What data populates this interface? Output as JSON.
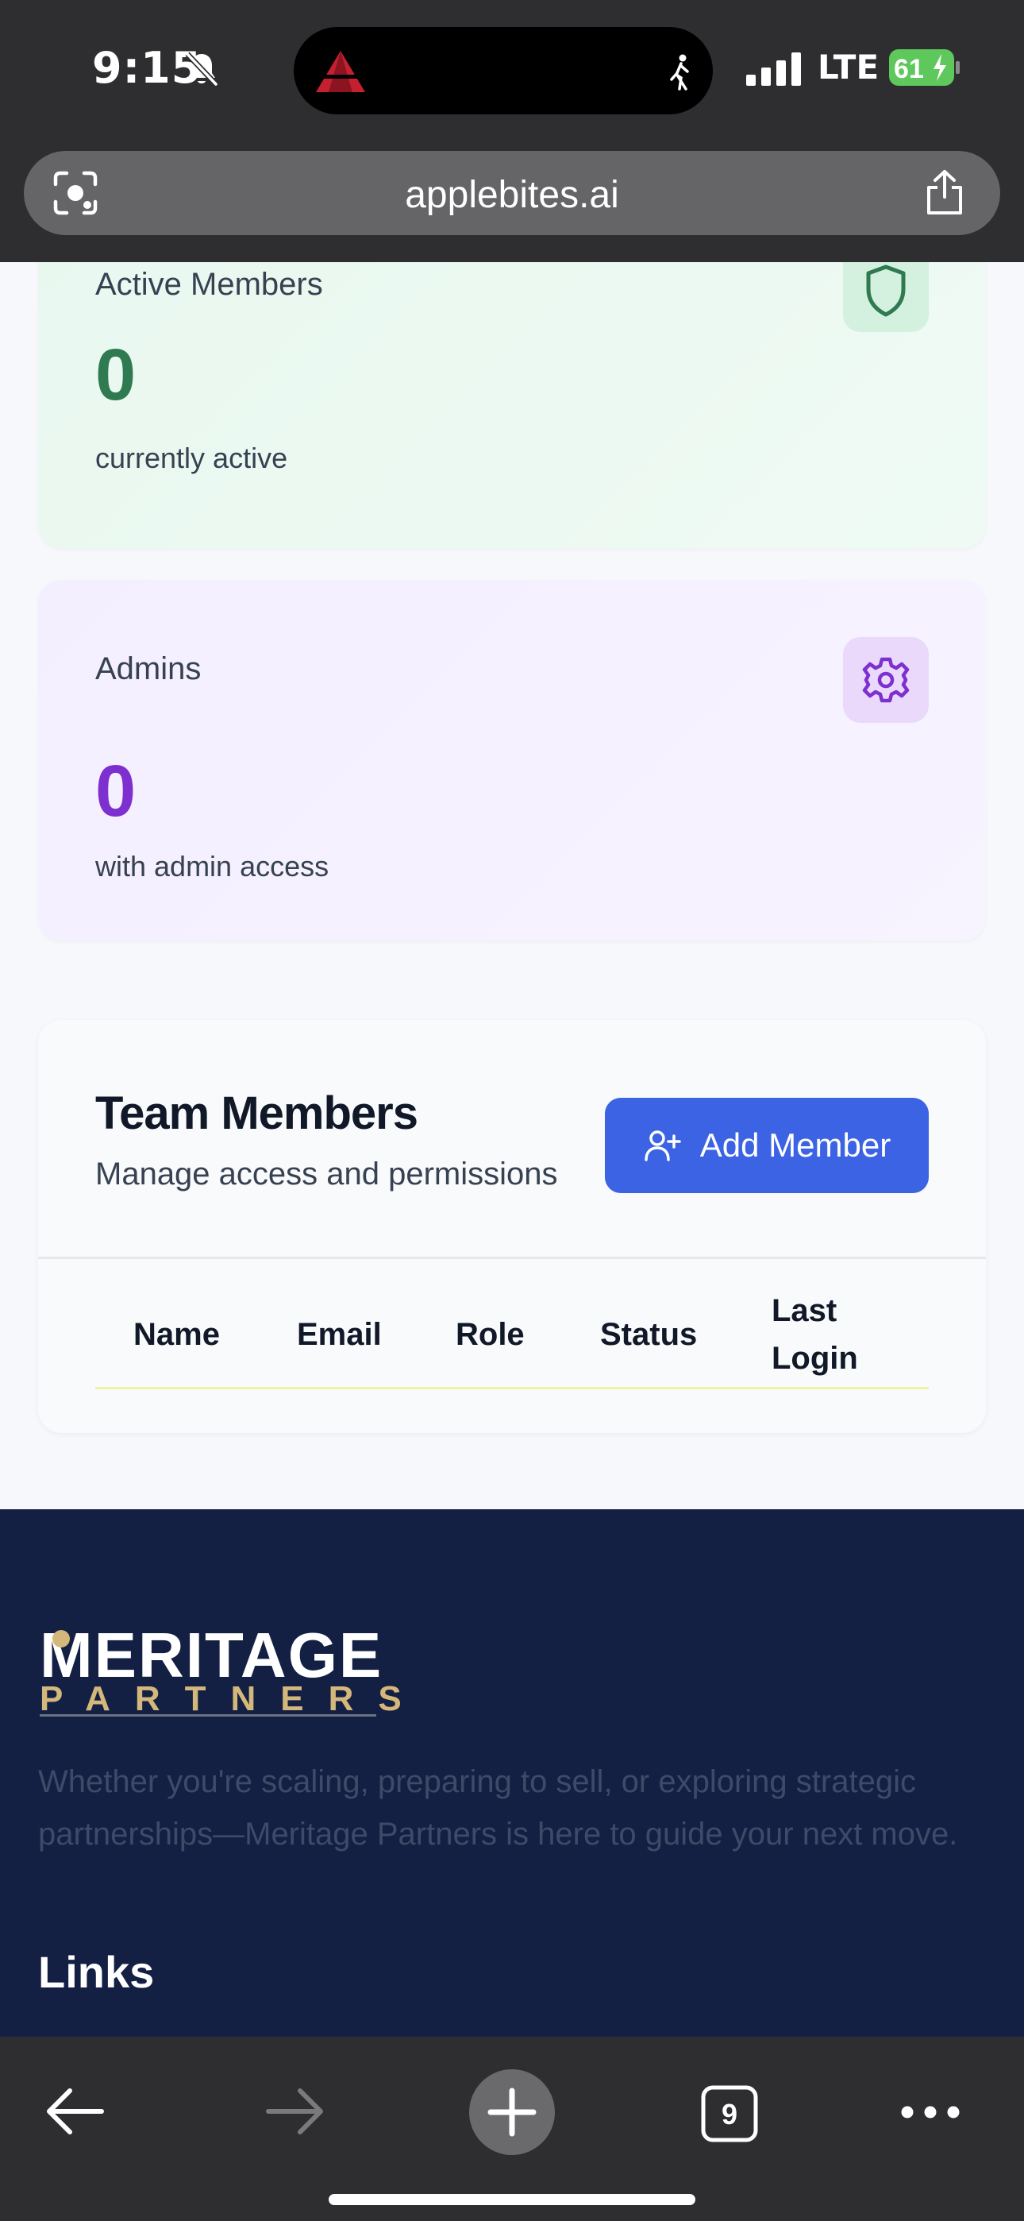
{
  "status_bar": {
    "time": "9:15",
    "carrier": "LTE",
    "battery": "61"
  },
  "browser": {
    "url": "applebites.ai",
    "tab_count": "9"
  },
  "stats": {
    "active": {
      "label": "Active Members",
      "value": "0",
      "sub": "currently active",
      "color": "#2f7a50"
    },
    "admins": {
      "label": "Admins",
      "value": "0",
      "sub": "with admin access",
      "color": "#7e2fd0"
    }
  },
  "team": {
    "title": "Team Members",
    "subtitle": "Manage access and permissions",
    "add_button": "Add Member",
    "columns": [
      "Name",
      "Email",
      "Role",
      "Status",
      "Last",
      "Login"
    ]
  },
  "footer": {
    "logo_top": "MERITAGE",
    "logo_bottom": "PARTNERS",
    "tagline": "Whether you're scaling, preparing to sell, or exploring strategic partnerships—Meritage Partners is here to guide your next move.",
    "links_title": "Links"
  }
}
